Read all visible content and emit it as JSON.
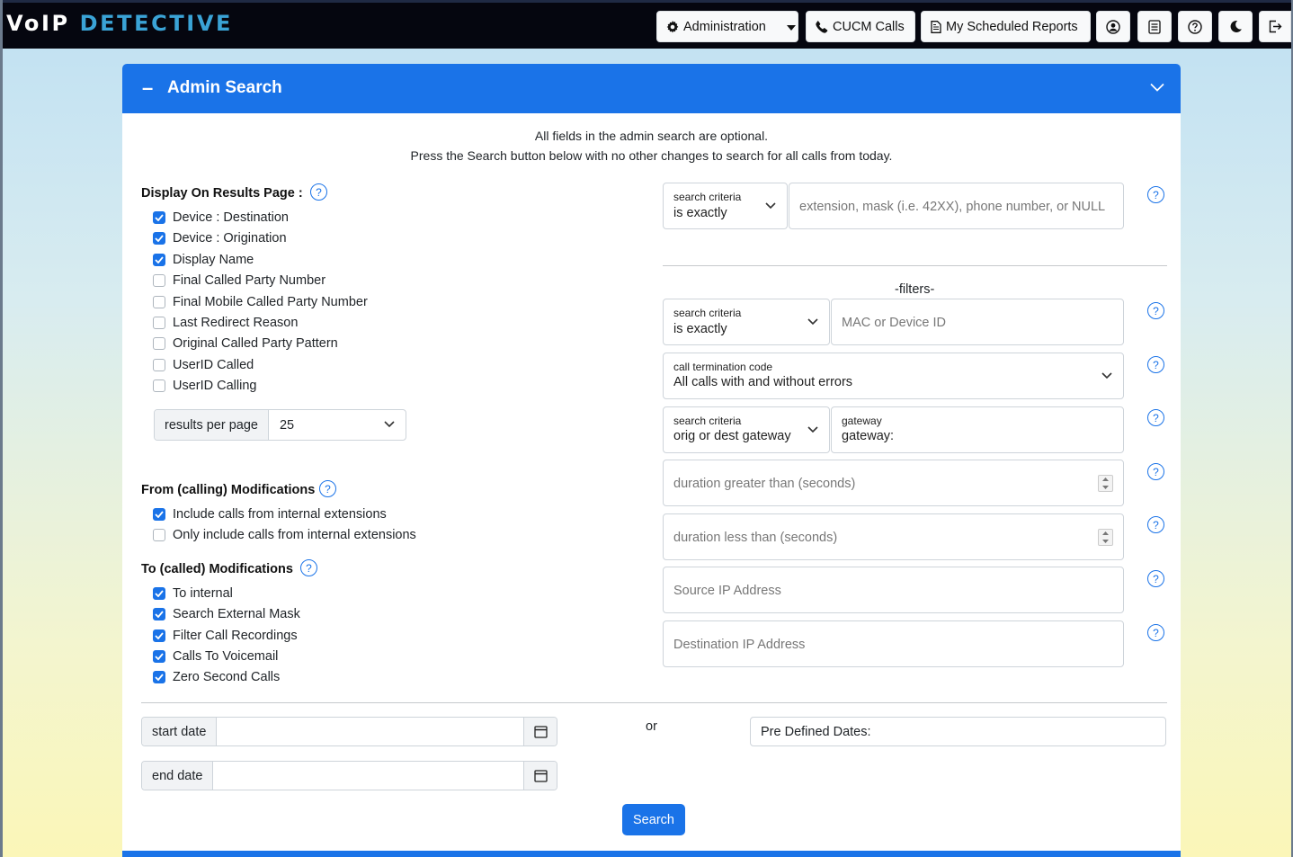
{
  "nav": {
    "logo_part1": "VoIP",
    "logo_part2": "DETECTIVE",
    "administration": "Administration",
    "cucm_calls": "CUCM Calls",
    "scheduled_reports": "My Scheduled Reports"
  },
  "panel": {
    "title": "Admin Search",
    "intro_line1": "All fields in the admin search are optional.",
    "intro_line2": "Press the Search button below with no other changes to search for all calls from today."
  },
  "display": {
    "title": "Display On Results Page :",
    "options": [
      {
        "label": "Device : Destination",
        "checked": true
      },
      {
        "label": "Device : Origination",
        "checked": true
      },
      {
        "label": "Display Name",
        "checked": true
      },
      {
        "label": "Final Called Party Number",
        "checked": false
      },
      {
        "label": "Final Mobile Called Party Number",
        "checked": false
      },
      {
        "label": "Last Redirect Reason",
        "checked": false
      },
      {
        "label": "Original Called Party Pattern",
        "checked": false
      },
      {
        "label": "UserID Called",
        "checked": false
      },
      {
        "label": "UserID Calling",
        "checked": false
      }
    ],
    "results_per_page_label": "results per page",
    "results_per_page_value": "25"
  },
  "from_mods": {
    "title": "From (calling) Modifications",
    "options": [
      {
        "label": "Include calls from internal extensions",
        "checked": true
      },
      {
        "label": "Only include calls from internal extensions",
        "checked": false
      }
    ]
  },
  "to_mods": {
    "title": "To (called) Modifications",
    "options": [
      {
        "label": "To internal",
        "checked": true
      },
      {
        "label": "Search External Mask",
        "checked": true
      },
      {
        "label": "Filter Call Recordings",
        "checked": true
      },
      {
        "label": "Calls To Voicemail",
        "checked": true
      },
      {
        "label": "Zero Second Calls",
        "checked": true
      }
    ]
  },
  "search": {
    "criteria_label": "search criteria",
    "criteria_value": "is exactly",
    "number_placeholder": "extension, mask (i.e. 42XX), phone number, or NULL"
  },
  "filters": {
    "heading": "-filters-",
    "device_criteria_label": "search criteria",
    "device_criteria_value": "is exactly",
    "device_placeholder": "MAC or Device ID",
    "term_code_label": "call termination code",
    "term_code_value": "All calls with and without errors",
    "gateway_criteria_label": "search criteria",
    "gateway_criteria_value": "orig or dest gateway",
    "gateway_label": "gateway",
    "gateway_value": "gateway:",
    "duration_gt_placeholder": "duration greater than (seconds)",
    "duration_lt_placeholder": "duration less than (seconds)",
    "source_ip_placeholder": "Source IP Address",
    "dest_ip_placeholder": "Destination IP Address"
  },
  "dates": {
    "start_label": "start date",
    "end_label": "end date",
    "or_label": "or",
    "predefined_label": "Pre Defined Dates:"
  },
  "actions": {
    "search_label": "Search"
  },
  "colors": {
    "primary": "#1a73e8",
    "navbar": "#05060f",
    "logo_accent": "#3aa3d6"
  }
}
